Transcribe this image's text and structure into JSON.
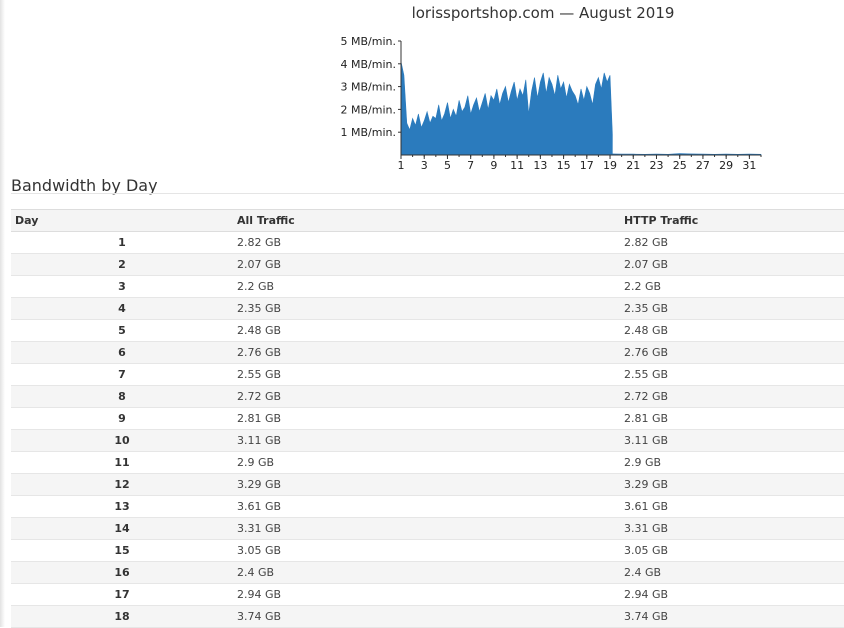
{
  "colors": {
    "bar": "#2b7bbd",
    "axis": "#333333",
    "header_bg": "#f4f4f4",
    "row_alt_bg": "#f5f5f5"
  },
  "chart_data": {
    "type": "area",
    "title": "lorissportshop.com — August 2019",
    "xlabel": "",
    "ylabel": "",
    "x_ticks": [
      "1",
      "3",
      "5",
      "7",
      "9",
      "11",
      "13",
      "15",
      "17",
      "19",
      "21",
      "23",
      "25",
      "27",
      "29",
      "31"
    ],
    "y_ticks": [
      "1 MB/min.",
      "2 MB/min.",
      "3 MB/min.",
      "4 MB/min.",
      "5 MB/min."
    ],
    "xlim": [
      1,
      32
    ],
    "ylim": [
      0,
      5
    ],
    "y_unit": "MB/min.",
    "grid": false,
    "series": [
      {
        "x": [
          1,
          1.25,
          1.5,
          1.75,
          2,
          2.25,
          2.5,
          2.75,
          3,
          3.25,
          3.5,
          3.75,
          4,
          4.25,
          4.5,
          4.75,
          5,
          5.25,
          5.5,
          5.75,
          6,
          6.25,
          6.5,
          6.75,
          7,
          7.25,
          7.5,
          7.75,
          8,
          8.25,
          8.5,
          8.75,
          9,
          9.25,
          9.5,
          9.75,
          10,
          10.25,
          10.5,
          10.75,
          11,
          11.25,
          11.5,
          11.75,
          12,
          12.25,
          12.5,
          12.75,
          13,
          13.25,
          13.5,
          13.75,
          14,
          14.25,
          14.5,
          14.75,
          15,
          15.25,
          15.5,
          15.75,
          16,
          16.25,
          16.5,
          16.75,
          17,
          17.25,
          17.5,
          17.75,
          18,
          18.25,
          18.5,
          18.75,
          19,
          19.2
        ],
        "y": [
          4.1,
          3.5,
          1.4,
          1.1,
          1.6,
          1.3,
          1.8,
          1.2,
          1.5,
          1.9,
          1.4,
          1.7,
          1.6,
          2.2,
          1.5,
          1.8,
          2.3,
          1.6,
          2.0,
          1.7,
          2.4,
          1.9,
          2.1,
          2.6,
          1.8,
          2.2,
          2.5,
          1.9,
          2.3,
          2.7,
          2.0,
          2.6,
          2.4,
          2.9,
          2.2,
          2.7,
          3.0,
          2.3,
          2.8,
          3.2,
          2.4,
          2.9,
          2.6,
          3.3,
          1.8,
          2.8,
          3.4,
          2.5,
          3.2,
          3.6,
          2.7,
          3.4,
          3.1,
          2.6,
          3.5,
          2.9,
          3.2,
          2.5,
          3.1,
          2.8,
          2.6,
          2.2,
          2.9,
          2.4,
          3.0,
          2.7,
          2.2,
          3.1,
          3.4,
          2.9,
          3.6,
          3.2,
          3.5,
          0.9
        ]
      },
      {
        "x": [
          19.2,
          20,
          21,
          22,
          23,
          24,
          25,
          26,
          27,
          28,
          29,
          30,
          31,
          32
        ],
        "y": [
          0.05,
          0.04,
          0.04,
          0.03,
          0.04,
          0.03,
          0.06,
          0.05,
          0.04,
          0.03,
          0.04,
          0.03,
          0.04,
          0.03
        ]
      }
    ]
  },
  "bandwidth": {
    "heading": "Bandwidth by Day",
    "columns": {
      "day": "Day",
      "all": "All Traffic",
      "http": "HTTP Traffic"
    },
    "rows": [
      {
        "day": "1",
        "all": "2.82 GB",
        "http": "2.82 GB"
      },
      {
        "day": "2",
        "all": "2.07 GB",
        "http": "2.07 GB"
      },
      {
        "day": "3",
        "all": "2.2 GB",
        "http": "2.2 GB"
      },
      {
        "day": "4",
        "all": "2.35 GB",
        "http": "2.35 GB"
      },
      {
        "day": "5",
        "all": "2.48 GB",
        "http": "2.48 GB"
      },
      {
        "day": "6",
        "all": "2.76 GB",
        "http": "2.76 GB"
      },
      {
        "day": "7",
        "all": "2.55 GB",
        "http": "2.55 GB"
      },
      {
        "day": "8",
        "all": "2.72 GB",
        "http": "2.72 GB"
      },
      {
        "day": "9",
        "all": "2.81 GB",
        "http": "2.81 GB"
      },
      {
        "day": "10",
        "all": "3.11 GB",
        "http": "3.11 GB"
      },
      {
        "day": "11",
        "all": "2.9 GB",
        "http": "2.9 GB"
      },
      {
        "day": "12",
        "all": "3.29 GB",
        "http": "3.29 GB"
      },
      {
        "day": "13",
        "all": "3.61 GB",
        "http": "3.61 GB"
      },
      {
        "day": "14",
        "all": "3.31 GB",
        "http": "3.31 GB"
      },
      {
        "day": "15",
        "all": "3.05 GB",
        "http": "3.05 GB"
      },
      {
        "day": "16",
        "all": "2.4 GB",
        "http": "2.4 GB"
      },
      {
        "day": "17",
        "all": "2.94 GB",
        "http": "2.94 GB"
      },
      {
        "day": "18",
        "all": "3.74 GB",
        "http": "3.74 GB"
      }
    ]
  }
}
